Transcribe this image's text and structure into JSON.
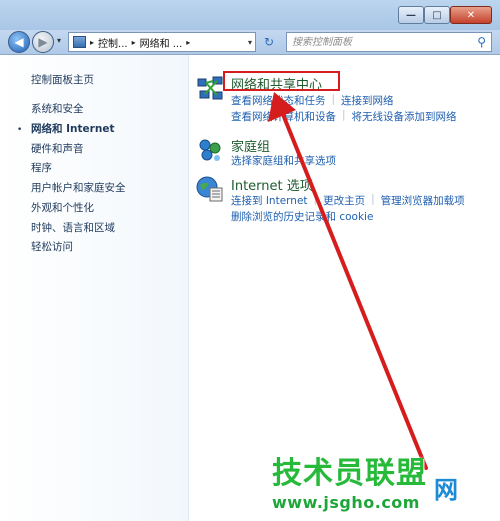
{
  "window": {
    "minimize_glyph": "—",
    "maximize_glyph": "□",
    "close_glyph": "✕"
  },
  "nav": {
    "back_glyph": "◀",
    "forward_glyph": "▶",
    "history_glyph": "▾",
    "breadcrumbs": [
      "控制...",
      "网络和 ..."
    ],
    "separator": "▸",
    "dropdown_glyph": "▾",
    "refresh_glyph": "↻",
    "search_placeholder": "搜索控制面板",
    "search_glyph": "⚲"
  },
  "sidebar": {
    "home": "控制面板主页",
    "items": [
      {
        "label": "系统和安全"
      },
      {
        "label": "网络和 Internet",
        "current": true
      },
      {
        "label": "硬件和声音"
      },
      {
        "label": "程序"
      },
      {
        "label": "用户帐户和家庭安全"
      },
      {
        "label": "外观和个性化"
      },
      {
        "label": "时钟、语言和区域"
      },
      {
        "label": "轻松访问"
      }
    ],
    "bullet": "•"
  },
  "sections": [
    {
      "title": "网络和共享中心",
      "icon": "network-sharing-icon",
      "links": [
        [
          "查看网络状态和任务",
          "连接到网络"
        ],
        [
          "查看网络计算机和设备",
          "将无线设备添加到网络"
        ]
      ]
    },
    {
      "title": "家庭组",
      "icon": "homegroup-icon",
      "links": [
        [
          "选择家庭组和共享选项"
        ]
      ]
    },
    {
      "title": "Internet 选项",
      "icon": "internet-options-icon",
      "links": [
        [
          "连接到 Internet",
          "更改主页",
          "管理浏览器加载项"
        ],
        [
          "删除浏览的历史记录和 cookie"
        ]
      ]
    }
  ],
  "watermark": {
    "main": "技术员联盟",
    "net": "网",
    "url": "www.jsgho.com"
  },
  "colors": {
    "link": "#2060b0",
    "section_title": "#1e5a2e",
    "highlight": "#d61d1d"
  }
}
